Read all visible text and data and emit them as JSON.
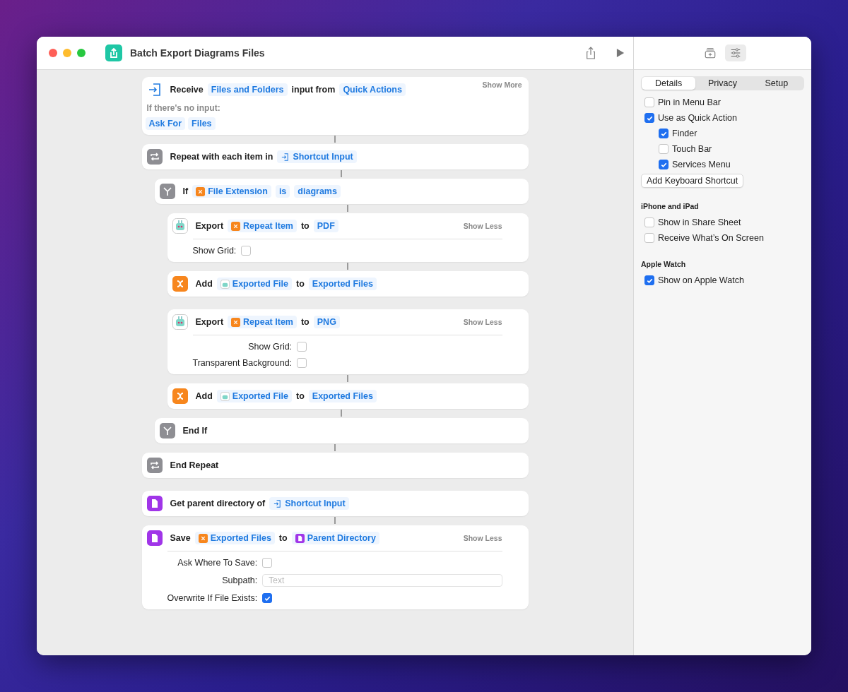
{
  "window": {
    "title": "Batch Export Diagrams Files"
  },
  "inspector_toggles": [
    {
      "kind": "library",
      "selected": false
    },
    {
      "kind": "details",
      "selected": true
    }
  ],
  "actions": [
    {
      "kind": "receive",
      "linked": false,
      "parts": [
        {
          "kind": "text",
          "text": "Receive"
        },
        {
          "kind": "token",
          "text": "Files and Folders"
        },
        {
          "kind": "text",
          "text": "input from"
        },
        {
          "kind": "token",
          "text": "Quick Actions"
        }
      ],
      "toggle": "Show More",
      "fallback": {
        "label": "If there's no input:",
        "tokens": [
          "Ask For",
          "Files"
        ]
      }
    },
    {
      "kind": "repeat",
      "linked": true,
      "parts": [
        {
          "kind": "text",
          "text": "Repeat with each item in"
        },
        {
          "kind": "input_token",
          "text": "Shortcut Input"
        }
      ],
      "children": [
        {
          "kind": "if",
          "linked": true,
          "parts": [
            {
              "kind": "text",
              "text": "If"
            },
            {
              "kind": "variable_token",
              "text": "File Extension"
            },
            {
              "kind": "token",
              "text": "is"
            },
            {
              "kind": "token",
              "text": "diagrams"
            }
          ],
          "children": [
            {
              "kind": "export",
              "linked": true,
              "parts": [
                {
                  "kind": "text",
                  "text": "Export"
                },
                {
                  "kind": "variable_token",
                  "text": "Repeat Item"
                },
                {
                  "kind": "text",
                  "text": "to"
                },
                {
                  "kind": "token",
                  "text": "PDF"
                }
              ],
              "toggle": "Show Less",
              "params": [
                {
                  "kind": "checkbox",
                  "label": "Show Grid:",
                  "checked": false
                }
              ]
            },
            {
              "kind": "variable",
              "linked": true,
              "parts": [
                {
                  "kind": "text",
                  "text": "Add"
                },
                {
                  "kind": "app_token",
                  "text": "Exported File"
                },
                {
                  "kind": "text",
                  "text": "to"
                },
                {
                  "kind": "token",
                  "text": "Exported Files"
                }
              ]
            },
            {
              "kind": "export",
              "linked": false,
              "parts": [
                {
                  "kind": "text",
                  "text": "Export"
                },
                {
                  "kind": "variable_token",
                  "text": "Repeat Item"
                },
                {
                  "kind": "text",
                  "text": "to"
                },
                {
                  "kind": "token",
                  "text": "PNG"
                }
              ],
              "toggle": "Show Less",
              "params": [
                {
                  "kind": "checkbox",
                  "label": "Show Grid:",
                  "checked": false
                },
                {
                  "kind": "checkbox",
                  "label": "Transparent Background:",
                  "checked": false
                }
              ]
            },
            {
              "kind": "variable",
              "linked": true,
              "parts": [
                {
                  "kind": "text",
                  "text": "Add"
                },
                {
                  "kind": "app_token",
                  "text": "Exported File"
                },
                {
                  "kind": "text",
                  "text": "to"
                },
                {
                  "kind": "token",
                  "text": "Exported Files"
                }
              ]
            }
          ]
        },
        {
          "kind": "if",
          "linked": true,
          "parts": [
            {
              "kind": "text",
              "text": "End If"
            }
          ]
        }
      ]
    },
    {
      "kind": "repeat",
      "linked": true,
      "parts": [
        {
          "kind": "text",
          "text": "End Repeat"
        }
      ]
    },
    {
      "kind": "file",
      "linked": false,
      "parts": [
        {
          "kind": "text",
          "text": "Get parent directory of"
        },
        {
          "kind": "input_token",
          "text": "Shortcut Input"
        }
      ]
    },
    {
      "kind": "file",
      "linked": true,
      "parts": [
        {
          "kind": "text",
          "text": "Save"
        },
        {
          "kind": "variable_token",
          "text": "Exported Files"
        },
        {
          "kind": "text",
          "text": "to"
        },
        {
          "kind": "file_token",
          "text": "Parent Directory"
        }
      ],
      "toggle": "Show Less",
      "params": [
        {
          "kind": "checkbox",
          "label": "Ask Where To Save:",
          "checked": false
        },
        {
          "kind": "field",
          "label": "Subpath:",
          "placeholder": "Text"
        },
        {
          "kind": "checkbox",
          "label": "Overwrite If File Exists:",
          "checked": true
        }
      ]
    }
  ],
  "inspector": {
    "tabs": [
      {
        "label": "Details",
        "selected": true
      },
      {
        "label": "Privacy",
        "selected": false
      },
      {
        "label": "Setup",
        "selected": false
      }
    ],
    "sections": [
      {
        "items": [
          {
            "kind": "checkbox",
            "label": "Pin in Menu Bar",
            "checked": false
          },
          {
            "kind": "checkbox",
            "label": "Use as Quick Action",
            "checked": true,
            "children": [
              {
                "kind": "checkbox",
                "label": "Finder",
                "checked": true
              },
              {
                "kind": "checkbox",
                "label": "Touch Bar",
                "checked": false
              },
              {
                "kind": "checkbox",
                "label": "Services Menu",
                "checked": true
              }
            ]
          },
          {
            "kind": "button",
            "label": "Add Keyboard Shortcut"
          }
        ]
      },
      {
        "title": "iPhone and iPad",
        "items": [
          {
            "kind": "checkbox",
            "label": "Show in Share Sheet",
            "checked": false
          },
          {
            "kind": "checkbox",
            "label": "Receive What’s On Screen",
            "checked": false
          }
        ]
      },
      {
        "title": "Apple Watch",
        "items": [
          {
            "kind": "checkbox",
            "label": "Show on Apple Watch",
            "checked": true
          }
        ]
      }
    ]
  }
}
